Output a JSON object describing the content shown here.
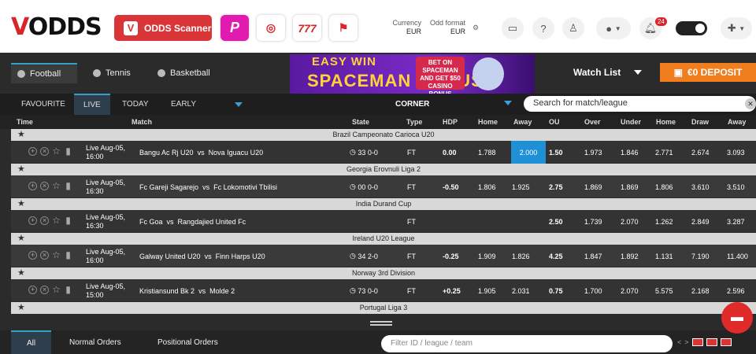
{
  "header": {
    "logo": "VODDS",
    "logo_v": "V",
    "logo_rest": "ODDS",
    "scanner_label": "ODDS Scanner",
    "tool_icons": [
      "p-icon",
      "casino-chip-icon",
      "slots-777-icon",
      "race-flag-icon"
    ],
    "slots_label": "777",
    "currency_label": "Currency",
    "currency_value": "EUR",
    "odds_format_label": "Odd format",
    "odds_format_value": "EUR",
    "notif_count": "24"
  },
  "sports": [
    {
      "label": "Football",
      "active": true
    },
    {
      "label": "Tennis",
      "active": false
    },
    {
      "label": "Basketball",
      "active": false
    }
  ],
  "banner": {
    "line1": "EASY WIN",
    "line2": "SPACEMAN BONUS",
    "promo": "BET ON SPACEMAN AND GET $50 CASINO BONUS"
  },
  "watchlist_label": "Watch List",
  "deposit_label": "€0  DEPOSIT",
  "filter_tabs": [
    {
      "label": "FAVOURITE"
    },
    {
      "label": "LIVE",
      "active": true
    },
    {
      "label": "TODAY"
    },
    {
      "label": "EARLY"
    }
  ],
  "market": "CORNER",
  "search_placeholder": "Search for match/league",
  "columns": [
    "Time",
    "Match",
    "State",
    "Type",
    "HDP",
    "Home",
    "Away",
    "OU",
    "Over",
    "Under",
    "Home",
    "Draw",
    "Away"
  ],
  "leagues": [
    {
      "name": "Brazil Campeonato Carioca U20",
      "match": {
        "time": "Live Aug-05, 16:00",
        "home": "Bangu Ac Rj U20",
        "vs": "vs",
        "away": "Nova Iguacu U20",
        "state": "33 0-0",
        "type": "FT",
        "hdp": "0.00",
        "hdp_home": "1.788",
        "hdp_away": "2.000",
        "ou": "1.50",
        "over": "1.973",
        "under": "1.846",
        "x12_home": "2.771",
        "draw": "2.674",
        "x12_away": "3.093"
      }
    },
    {
      "name": "Georgia Erovnuli Liga 2",
      "match": {
        "time": "Live Aug-05, 16:30",
        "home": "Fc Gareji Sagarejo",
        "vs": "vs",
        "away": "Fc Lokomotivi Tbilisi",
        "state": "00 0-0",
        "type": "FT",
        "hdp": "-0.50",
        "hdp_home": "1.806",
        "hdp_away": "1.925",
        "ou": "2.75",
        "over": "1.869",
        "under": "1.869",
        "x12_home": "1.806",
        "draw": "3.610",
        "x12_away": "3.510"
      }
    },
    {
      "name": "India Durand Cup",
      "match": {
        "time": "Live Aug-05, 16:30",
        "home": "Fc Goa",
        "vs": "vs",
        "away": "Rangdajied United Fc",
        "state": "",
        "type": "FT",
        "hdp": "",
        "hdp_home": "",
        "hdp_away": "",
        "ou": "2.50",
        "over": "1.739",
        "under": "2.070",
        "x12_home": "1.262",
        "draw": "2.849",
        "x12_away": "3.287"
      }
    },
    {
      "name": "Ireland U20 League",
      "match": {
        "time": "Live Aug-05, 16:00",
        "home": "Galway United U20",
        "vs": "vs",
        "away": "Finn Harps U20",
        "state": "34 2-0",
        "type": "FT",
        "hdp": "-0.25",
        "hdp_home": "1.909",
        "hdp_away": "1.826",
        "ou": "4.25",
        "over": "1.847",
        "under": "1.892",
        "x12_home": "1.131",
        "draw": "7.190",
        "x12_away": "11.400"
      }
    },
    {
      "name": "Norway 3rd Division",
      "match": {
        "time": "Live Aug-05, 15:00",
        "home": "Kristiansund Bk 2",
        "vs": "vs",
        "away": "Molde 2",
        "state": "73 0-0",
        "type": "FT",
        "hdp": "+0.25",
        "hdp_home": "1.905",
        "hdp_away": "2.031",
        "ou": "0.75",
        "over": "1.700",
        "under": "2.070",
        "x12_home": "5.575",
        "draw": "2.168",
        "x12_away": "2.596"
      }
    },
    {
      "name": "Portugal Liga 3"
    }
  ],
  "bottom_tabs": [
    {
      "label": "All",
      "active": true
    },
    {
      "label": "Normal Orders"
    },
    {
      "label": "Positional Orders"
    }
  ],
  "bottom_search_placeholder": "Filter ID / league / team",
  "accent": "#33a0c8",
  "brand_red": "#d6262a"
}
